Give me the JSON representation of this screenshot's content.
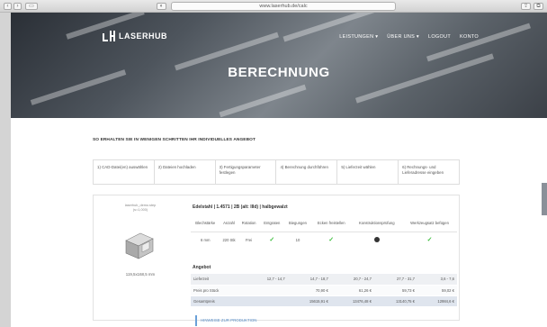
{
  "browser": {
    "url": "www.laserhub.de/calc",
    "left_buttons": [
      "",
      "",
      ""
    ],
    "right_buttons": [
      "",
      ""
    ]
  },
  "brand": {
    "name": "LASERHUB"
  },
  "nav": {
    "items": [
      "LEISTUNGEN ▾",
      "ÜBER UNS ▾",
      "LOGOUT",
      "KONTO"
    ]
  },
  "hero": {
    "title": "BERECHNUNG"
  },
  "intro": {
    "text": "SO ERHALTEN SIE IN WENIGEN SCHRITTEN IHR INDIVIDUELLES ANGEBOT"
  },
  "steps": [
    "1) CAD-Datei(en) auswählen",
    "2) Dateien hochladen",
    "3) Fertigungsparameter festlegen",
    "4) Berechnung durchführen",
    "5) Lieferzeit wählen",
    "6) Rechnungs- und Lieferadresse eingeben"
  ],
  "part": {
    "filename": "laserhub_demo.step",
    "filename_sub": "(s=1,000)",
    "dimensions": "119,5x168,5 mm"
  },
  "material": {
    "title": "Edelstahl | 1.4571 | 2B (alt: IIId) | halbgewalzt"
  },
  "spec_table": {
    "headers": [
      "Blechstärke",
      "Anzahl",
      "Rotation",
      "Entgraten",
      "Biegungen",
      "Ecken freistellen",
      "Konstruktionsprüfung",
      "Werkzeugsatz befügen"
    ],
    "row": [
      "6 mm",
      "220 Stk",
      "Frei",
      "✓",
      "10",
      "✓",
      "●",
      "✓"
    ]
  },
  "offer": {
    "section_title": "Angebot",
    "rows": [
      {
        "label": "Lieferzeit",
        "values": [
          "12,7 - 14,7",
          "14,7 - 18,7",
          "20,7 - 24,7",
          "27,7 - 31,7",
          "3,6 - 7,6"
        ]
      },
      {
        "label": "Preis pro Stück",
        "values": [
          "",
          "70,90 €",
          "61,26 €",
          "59,73 €",
          "59,02 €"
        ]
      },
      {
        "label": "Gesamtpreis",
        "values": [
          "",
          "15615,91 €",
          "13476,48 €",
          "13140,75 €",
          "12984,6 €"
        ]
      }
    ]
  },
  "actions": {
    "add_to_production": "HINWEISE ZUR PRODUKTION"
  }
}
